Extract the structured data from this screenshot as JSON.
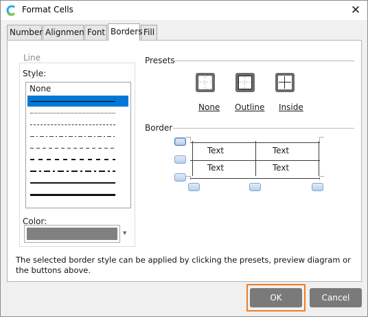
{
  "window": {
    "title": "Format Cells",
    "close_label": "✕"
  },
  "tabs": [
    {
      "label": "Number",
      "active": false
    },
    {
      "label": "Alignment",
      "active": false
    },
    {
      "label": "Font",
      "active": false
    },
    {
      "label": "Borders",
      "active": true
    },
    {
      "label": "Fill",
      "active": false
    }
  ],
  "line": {
    "legend": "Line",
    "style_label": "Style:",
    "styles": [
      "None",
      "thin-solid",
      "dotted",
      "dash-small",
      "dash-dot",
      "dash-medium",
      "dash-thick",
      "dash-dot-thick",
      "medium-solid",
      "thick-solid"
    ],
    "selected_style": "thin-solid",
    "color_label": "Color:",
    "color_value": "#808080"
  },
  "presets": {
    "label": "Presets",
    "buttons": [
      {
        "label": "None",
        "icon": "preset-none-icon"
      },
      {
        "label": "Outline",
        "icon": "preset-outline-icon"
      },
      {
        "label": "Inside",
        "icon": "preset-inside-icon"
      }
    ]
  },
  "border": {
    "label": "Border",
    "preview_cells": [
      "Text",
      "Text",
      "Text",
      "Text"
    ]
  },
  "info_text": "The selected border style can be applied by clicking the presets, preview diagram or the buttons above.",
  "buttons": {
    "ok": "OK",
    "cancel": "Cancel"
  },
  "colors": {
    "accent_selection": "#0078d7",
    "highlight_outline": "#f07c22",
    "button_bg": "#7a7a7a"
  }
}
